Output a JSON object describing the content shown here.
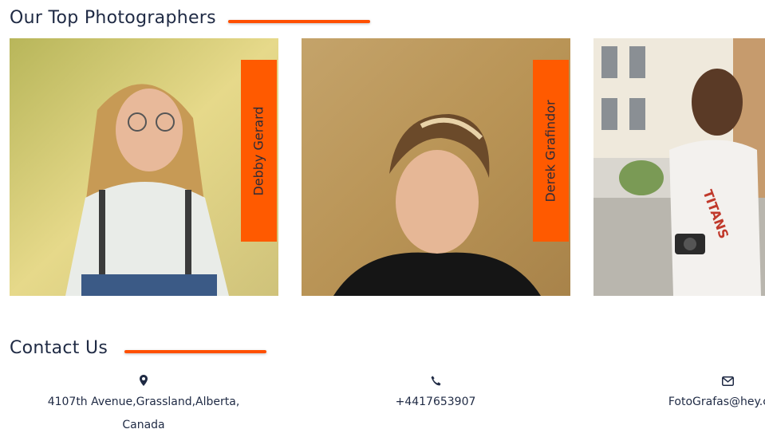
{
  "photographers_section": {
    "title": "Our Top Photographers",
    "accent_color": "#ff5a00",
    "cards": [
      {
        "name": "Debby Gerard",
        "photo": "woman-with-glasses-photo"
      },
      {
        "name": "Derek Grafindor",
        "photo": "young-man-portrait-photo"
      },
      {
        "name": "",
        "photo": "man-with-camera-street-photo"
      }
    ]
  },
  "contact_section": {
    "title": "Contact Us",
    "address": {
      "icon": "map-pin-icon",
      "line1": "4107th Avenue,Grassland,Alberta,",
      "line2": "Canada"
    },
    "phone": {
      "icon": "phone-icon",
      "value": "+4417653907"
    },
    "email": {
      "icon": "envelope-icon",
      "value": "FotoGrafas@hey.com"
    }
  }
}
